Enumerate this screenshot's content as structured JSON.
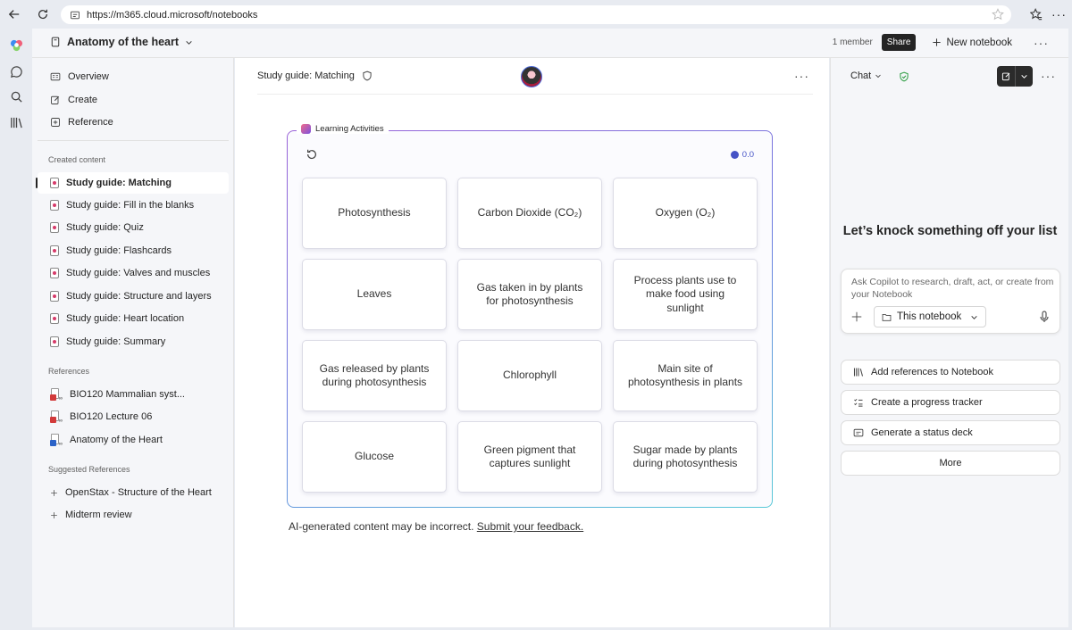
{
  "browser": {
    "url": "https://m365.cloud.microsoft/notebooks"
  },
  "header": {
    "notebook_title": "Anatomy of the heart",
    "member_count": "1 member",
    "share_label": "Share",
    "new_notebook_label": "New notebook"
  },
  "sidebar": {
    "nav": [
      {
        "label": "Overview"
      },
      {
        "label": "Create"
      },
      {
        "label": "Reference"
      }
    ],
    "created_content_heading": "Created content",
    "created_content": [
      {
        "label": "Study guide: Matching"
      },
      {
        "label": "Study guide: Fill in the blanks"
      },
      {
        "label": "Study guide: Quiz"
      },
      {
        "label": "Study guide: Flashcards"
      },
      {
        "label": "Study guide: Valves and muscles"
      },
      {
        "label": "Study guide: Structure and layers"
      },
      {
        "label": "Study guide: Heart location"
      },
      {
        "label": "Study guide: Summary"
      }
    ],
    "references_heading": "References",
    "references": [
      {
        "label": "BIO120 Mammalian syst..."
      },
      {
        "label": "BIO120 Lecture 06"
      },
      {
        "label": "Anatomy of the Heart"
      }
    ],
    "suggested_heading": "Suggested References",
    "suggested": [
      {
        "label": "OpenStax - Structure of the Heart"
      },
      {
        "label": "Midterm review"
      }
    ]
  },
  "main": {
    "page_title": "Study guide: Matching",
    "activity_label": "Learning Activities",
    "timer_value": "0.0",
    "cards": [
      "Photosynthesis",
      "Carbon Dioxide (CO₂)",
      "Oxygen (O₂)",
      "Leaves",
      "Gas taken in by plants for photosynthesis",
      "Process plants use to make food using sunlight",
      "Gas released by plants during photosynthesis",
      "Chlorophyll",
      "Main site of photosynthesis in plants",
      "Glucose",
      "Green pigment that captures sunlight",
      "Sugar made by plants during photosynthesis"
    ],
    "disclaimer": "AI-generated content may be incorrect.",
    "feedback_link": "Submit your feedback."
  },
  "chat": {
    "mode_label": "Chat",
    "headline": "Let’s knock something off your list",
    "prompt_placeholder": "Ask Copilot to research, draft, act, or create from your Notebook",
    "scope_label": "This notebook",
    "suggestions": [
      {
        "label": "Add references to Notebook",
        "icon": "library-icon"
      },
      {
        "label": "Create a progress tracker",
        "icon": "checklist-icon"
      },
      {
        "label": "Generate a status deck",
        "icon": "slides-icon"
      }
    ],
    "more_label": "More"
  },
  "colors": {
    "accent_border_start": "#9a62d8",
    "accent_border_end": "#58c9d7",
    "timer": "#4653c6",
    "shield_green": "#2f9e44"
  }
}
